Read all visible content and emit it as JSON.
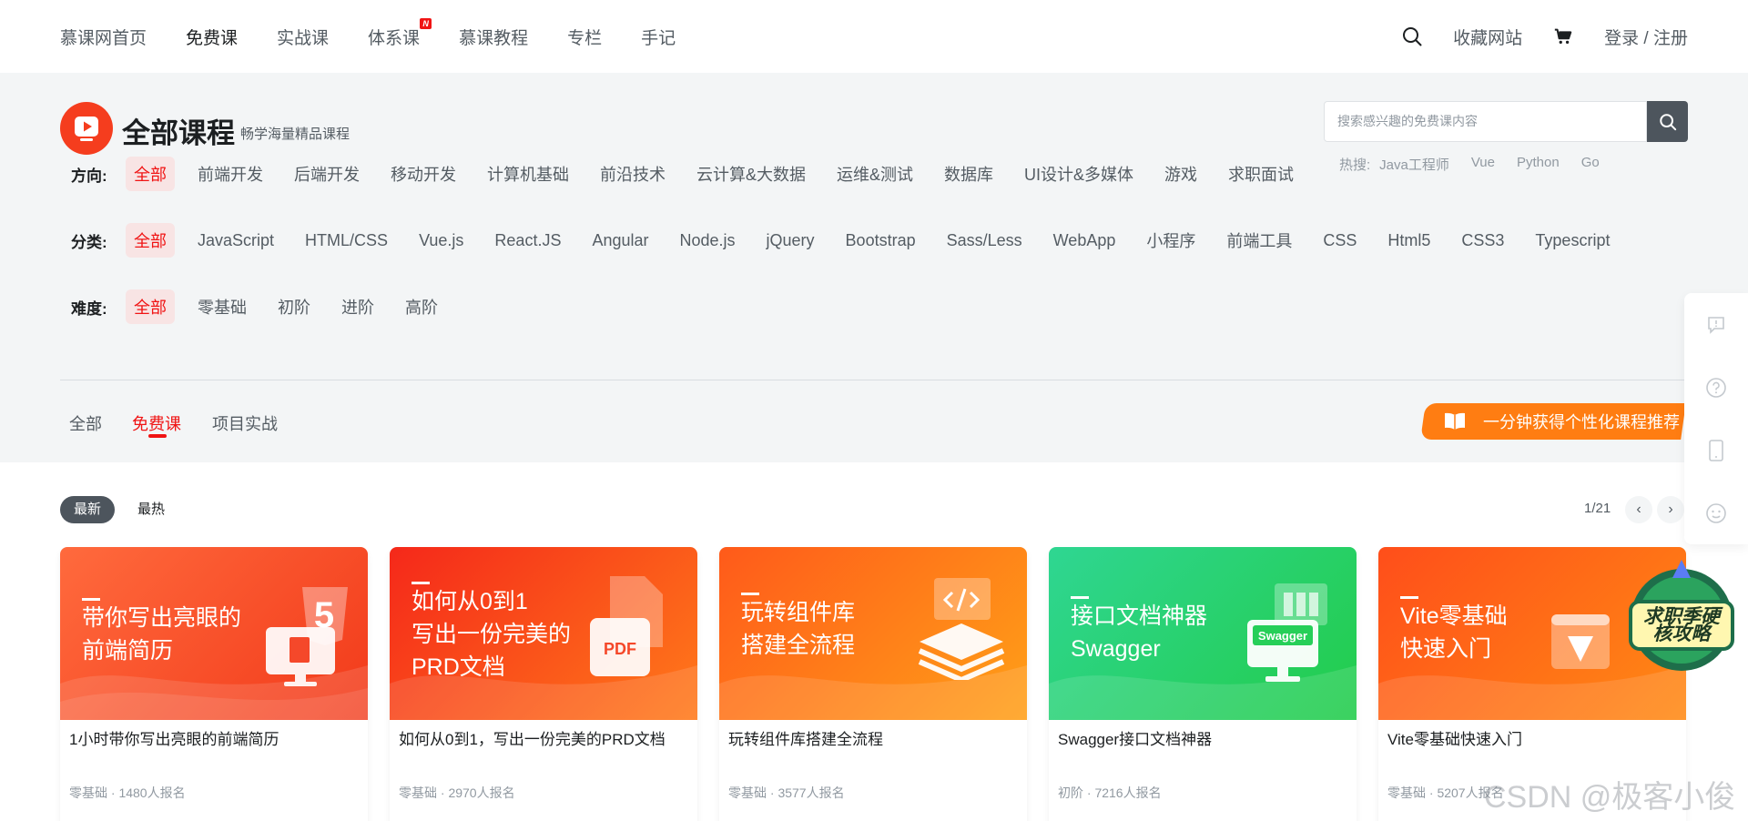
{
  "nav": {
    "links": [
      {
        "label": "慕课网首页"
      },
      {
        "label": "免费课"
      },
      {
        "label": "实战课"
      },
      {
        "label": "体系课",
        "badge": "N"
      },
      {
        "label": "慕课教程"
      },
      {
        "label": "专栏"
      },
      {
        "label": "手记"
      }
    ],
    "active_index": 1,
    "favorite_label": "收藏网站",
    "login_label": "登录 / 注册"
  },
  "header": {
    "title": "全部课程",
    "subtitle": "畅学海量精品课程",
    "search_placeholder": "搜索感兴趣的免费课内容",
    "hot_label": "热搜:",
    "hot_terms": [
      "Java工程师",
      "Vue",
      "Python",
      "Go"
    ]
  },
  "filters": {
    "direction": {
      "label": "方向:",
      "items": [
        "全部",
        "前端开发",
        "后端开发",
        "移动开发",
        "计算机基础",
        "前沿技术",
        "云计算&大数据",
        "运维&测试",
        "数据库",
        "UI设计&多媒体",
        "游戏",
        "求职面试"
      ]
    },
    "category": {
      "label": "分类:",
      "items": [
        "全部",
        "JavaScript",
        "HTML/CSS",
        "Vue.js",
        "React.JS",
        "Angular",
        "Node.js",
        "jQuery",
        "Bootstrap",
        "Sass/Less",
        "WebApp",
        "小程序",
        "前端工具",
        "CSS",
        "Html5",
        "CSS3",
        "Typescript"
      ]
    },
    "difficulty": {
      "label": "难度:",
      "items": [
        "全部",
        "零基础",
        "初阶",
        "进阶",
        "高阶"
      ]
    }
  },
  "tabs": [
    "全部",
    "免费课",
    "项目实战"
  ],
  "active_tab": "免费课",
  "recommend_label": "一分钟获得个性化课程推荐",
  "sort": {
    "newest": "最新",
    "hottest": "最热"
  },
  "pager": {
    "text": "1/21",
    "prev": "‹",
    "next": "›"
  },
  "courses": [
    {
      "cover_text": "带你写出亮眼的\n前端简历",
      "title": "1小时带你写出亮眼的前端简历",
      "level": "零基础",
      "enrolled": "1480人报名",
      "color_from": "#ff6a3d",
      "color_to": "#f23a1a",
      "art": "html5-icon"
    },
    {
      "cover_text": "如何从0到1\n写出一份完美的\nPRD文档",
      "title": "如何从0到1，写出一份完美的PRD文档",
      "level": "零基础",
      "enrolled": "2970人报名",
      "color_from": "#f5281a",
      "color_to": "#ff7a1a",
      "art": "pdf-icon"
    },
    {
      "cover_text": "玩转组件库\n搭建全流程",
      "title": "玩转组件库搭建全流程",
      "level": "零基础",
      "enrolled": "3577人报名",
      "color_from": "#ff5a1a",
      "color_to": "#ffa018",
      "art": "layers-icon"
    },
    {
      "cover_text": "接口文档神器\nSwagger",
      "title": "Swagger接口文档神器",
      "level": "初阶",
      "enrolled": "7216人报名",
      "color_from": "#2fd692",
      "color_to": "#22cc4a",
      "art": "swagger-icon"
    },
    {
      "cover_text": "Vite零基础\n快速入门",
      "title": "Vite零基础快速入门",
      "level": "零基础",
      "enrolled": "5207人报名",
      "color_from": "#ff4e1a",
      "color_to": "#ff8a14",
      "art": "vite-icon"
    }
  ],
  "promo_label": "求职季硬核攻略",
  "watermark": "CSDN @极客小俊"
}
